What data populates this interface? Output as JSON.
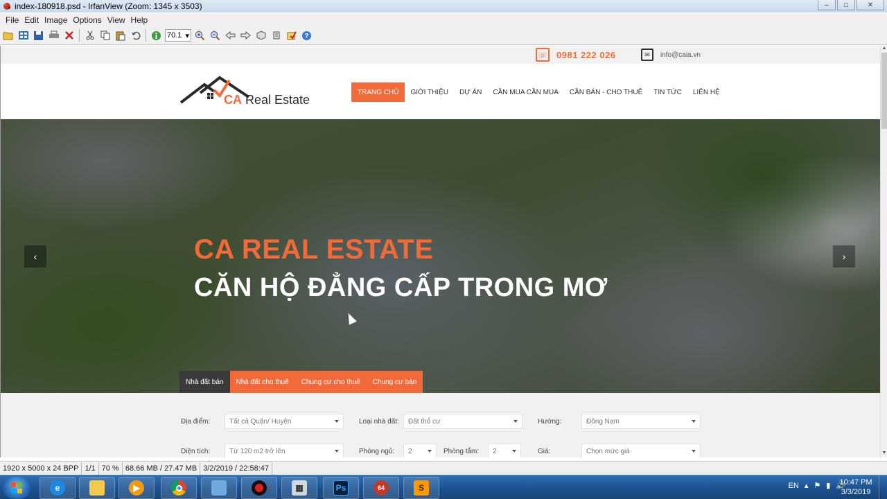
{
  "window": {
    "title": "index-180918.psd - IrfanView (Zoom: 1345 x 3503)",
    "controls": [
      "–",
      "□",
      "✕"
    ]
  },
  "menu": [
    "File",
    "Edit",
    "Image",
    "Options",
    "View",
    "Help"
  ],
  "toolbar": {
    "zoom_value": "70.1",
    "icons": [
      "open-icon",
      "thumbnails-icon",
      "save-icon",
      "print-icon",
      "delete-icon",
      "cut-icon",
      "copy-icon",
      "paste-icon",
      "undo-icon",
      "info-icon",
      "zoom-in-icon",
      "zoom-out-icon",
      "previous-icon",
      "next-icon",
      "rotate-left-icon",
      "rotate-right-icon",
      "edit-icon",
      "help-icon"
    ]
  },
  "website": {
    "phone": "0981 222 026",
    "email": "info@caia.vn",
    "logo": {
      "brand": "CA",
      "name": "Real Estate"
    },
    "nav": [
      "TRANG CHỦ",
      "GIỚI THIỆU",
      "DỰ ÁN",
      "CẦN MUA CẦN MUA",
      "CẦN BÁN - CHO THUÊ",
      "TIN TỨC",
      "LIÊN HỆ"
    ],
    "hero": {
      "title": "CA REAL ESTATE",
      "subtitle": "CĂN HỘ ĐẲNG CẤP  TRONG MƠ",
      "prev": "‹",
      "next": "›"
    },
    "tabs": [
      "Nhà đất bán",
      "Nhà đất cho thuê",
      "Chung cư cho thuê",
      "Chung cư bán"
    ],
    "search": {
      "row1": [
        {
          "label": "Địa điểm:",
          "value": "Tất cả Quận/ Huyện"
        },
        {
          "label": "Loại nhà đất:",
          "value": "Đất thổ cư"
        },
        {
          "label": "Hướng:",
          "value": "Đông Nam"
        }
      ],
      "row2": [
        {
          "label": "Diện tích:",
          "value": "Từ 120 m2 trở lên"
        },
        {
          "label": "Phòng ngủ:",
          "value": "2"
        },
        {
          "label": "Phòng tắm:",
          "value": "2"
        },
        {
          "label": "Giá:",
          "value": "Chọn mức giá"
        }
      ]
    }
  },
  "statusbar": [
    "1920 x 5000 x 24 BPP",
    "1/1",
    "70 %",
    "68.66 MB / 27.47 MB",
    "3/2/2019 / 22:58:47"
  ],
  "taskbar": {
    "language": "EN",
    "time": "10:47 PM",
    "date": "3/3/2019",
    "apps": [
      "internet-explorer-icon",
      "file-explorer-icon",
      "media-player-icon",
      "chrome-icon",
      "box-app-icon",
      "record-icon",
      "calculator-icon",
      "photoshop-icon",
      "irfanview-icon",
      "sublime-text-icon"
    ],
    "photoshop_label": "Ps",
    "irfanview_badge": "64",
    "sublime_label": "S"
  },
  "colors": {
    "accent": "#f26a3a",
    "dark_tab": "#3a3a3a"
  }
}
